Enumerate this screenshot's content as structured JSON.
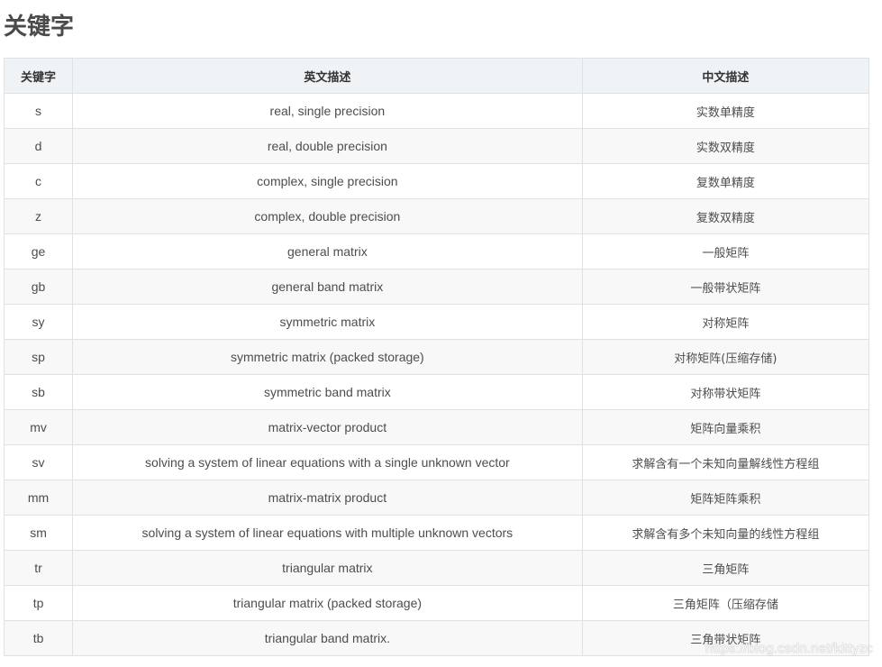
{
  "title": "关键字",
  "table": {
    "headers": [
      "关键字",
      "英文描述",
      "中文描述"
    ],
    "rows": [
      [
        "s",
        "real, single precision",
        "实数单精度"
      ],
      [
        "d",
        "real, double precision",
        "实数双精度"
      ],
      [
        "c",
        "complex, single precision",
        "复数单精度"
      ],
      [
        "z",
        "complex, double precision",
        "复数双精度"
      ],
      [
        "ge",
        "general matrix",
        "一般矩阵"
      ],
      [
        "gb",
        "general band matrix",
        "一般带状矩阵"
      ],
      [
        "sy",
        "symmetric matrix",
        "对称矩阵"
      ],
      [
        "sp",
        "symmetric matrix (packed storage)",
        "对称矩阵(压缩存储)"
      ],
      [
        "sb",
        "symmetric band matrix",
        "对称带状矩阵"
      ],
      [
        "mv",
        "matrix-vector product",
        "矩阵向量乘积"
      ],
      [
        "sv",
        "solving a system of linear equations with a single unknown vector",
        "求解含有一个未知向量解线性方程组"
      ],
      [
        "mm",
        "matrix-matrix product",
        "矩阵矩阵乘积"
      ],
      [
        "sm",
        "solving a system of linear equations with multiple unknown vectors",
        "求解含有多个未知向量的线性方程组"
      ],
      [
        "tr",
        "triangular matrix",
        "三角矩阵"
      ],
      [
        "tp",
        "triangular matrix (packed storage)",
        "三角矩阵（压缩存储"
      ],
      [
        "tb",
        "triangular band matrix.",
        "三角带状矩阵"
      ]
    ]
  },
  "watermark": "https://blog.csdn.net/kittyzc"
}
